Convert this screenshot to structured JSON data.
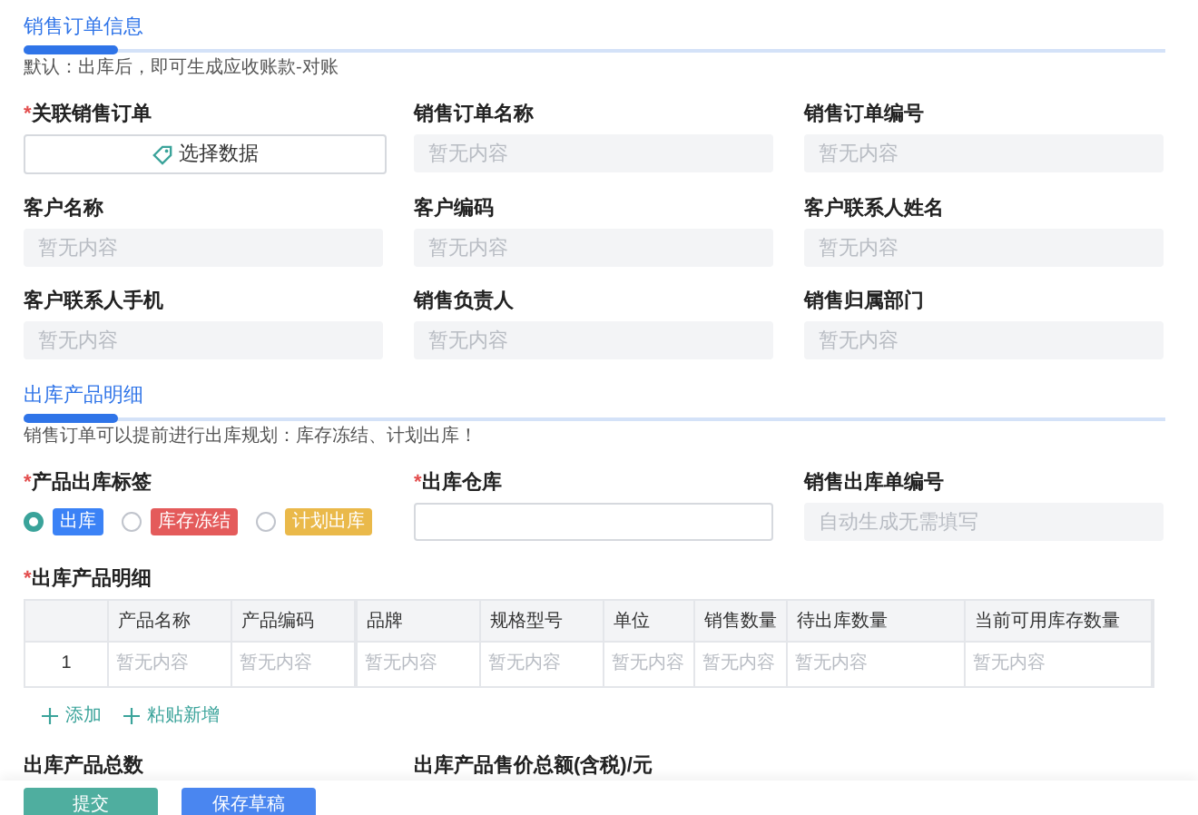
{
  "required_mark": "*",
  "section_order": {
    "title": "销售订单信息",
    "note": "默认：出库后，即可生成应收账款-对账"
  },
  "order_fields": [
    {
      "label": "关联销售订单",
      "required": true,
      "kind": "picker",
      "value": "选择数据"
    },
    {
      "label": "销售订单名称",
      "required": false,
      "kind": "readonly",
      "placeholder": "暂无内容"
    },
    {
      "label": "销售订单编号",
      "required": false,
      "kind": "readonly",
      "placeholder": "暂无内容"
    },
    {
      "label": "客户名称",
      "required": false,
      "kind": "readonly",
      "placeholder": "暂无内容"
    },
    {
      "label": "客户编码",
      "required": false,
      "kind": "readonly",
      "placeholder": "暂无内容"
    },
    {
      "label": "客户联系人姓名",
      "required": false,
      "kind": "readonly",
      "placeholder": "暂无内容"
    },
    {
      "label": "客户联系人手机",
      "required": false,
      "kind": "readonly",
      "placeholder": "暂无内容"
    },
    {
      "label": "销售负责人",
      "required": false,
      "kind": "readonly",
      "placeholder": "暂无内容"
    },
    {
      "label": "销售归属部门",
      "required": false,
      "kind": "readonly",
      "placeholder": "暂无内容"
    }
  ],
  "section_products": {
    "title": "出库产品明细",
    "note": "销售订单可以提前进行出库规划：库存冻结、计划出库！"
  },
  "tag_field": {
    "label": "产品出库标签",
    "required": true,
    "options": [
      {
        "label": "出库",
        "selected": true,
        "color": "#3b82f6"
      },
      {
        "label": "库存冻结",
        "selected": false,
        "color": "#e45b5b"
      },
      {
        "label": "计划出库",
        "selected": false,
        "color": "#eab94a"
      }
    ]
  },
  "warehouse_fields": [
    {
      "label": "出库仓库",
      "required": true,
      "kind": "input"
    },
    {
      "label": "销售出库单编号",
      "required": false,
      "kind": "readonly",
      "placeholder": "自动生成无需填写"
    }
  ],
  "table": {
    "label": "出库产品明细",
    "required": true,
    "columns": [
      "产品名称",
      "产品编码",
      "品牌",
      "规格型号",
      "单位",
      "销售数量",
      "待出库数量",
      "当前可用库存数量"
    ],
    "rows": [
      {
        "index": "1",
        "cells": [
          "暂无内容",
          "暂无内容",
          "暂无内容",
          "暂无内容",
          "暂无内容",
          "暂无内容",
          "暂无内容",
          "暂无内容"
        ]
      }
    ]
  },
  "table_actions": [
    "添加",
    "粘贴新增"
  ],
  "summary_fields": [
    "出库产品总数",
    "出库产品售价总额(含税)/元"
  ],
  "buttons": [
    {
      "label": "提交",
      "kind": "primary"
    },
    {
      "label": "保存草稿",
      "kind": "secondary"
    }
  ]
}
